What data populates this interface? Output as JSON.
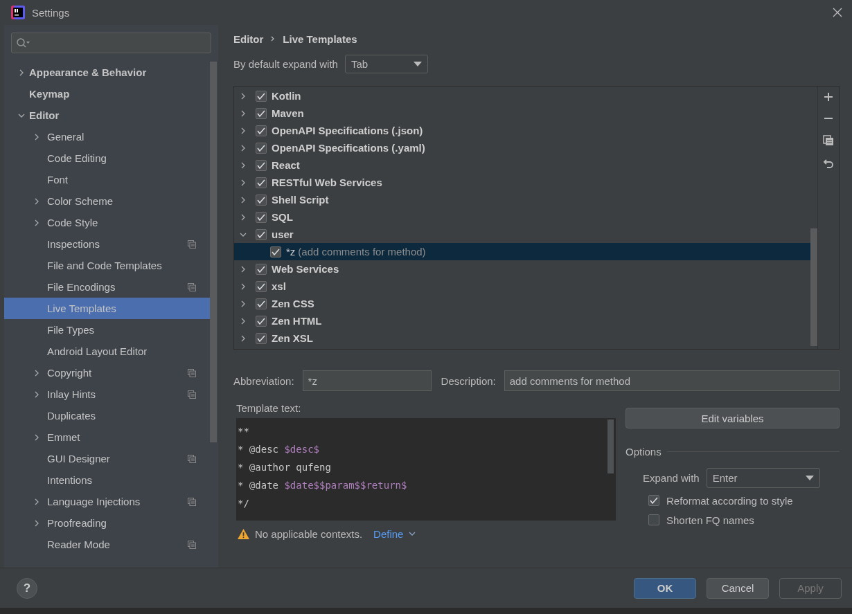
{
  "window": {
    "title": "Settings"
  },
  "sidebar": {
    "items": [
      {
        "name": "Appearance & Behavior",
        "bold": true,
        "expanded": false,
        "selected": false
      },
      {
        "name": "Keymap",
        "bold": true,
        "selected": false
      },
      {
        "name": "Editor",
        "bold": true,
        "expanded": true,
        "selected": false,
        "children": [
          {
            "name": "General",
            "expanded": false,
            "selected": false
          },
          {
            "name": "Code Editing",
            "selected": false
          },
          {
            "name": "Font",
            "selected": false
          },
          {
            "name": "Color Scheme",
            "expanded": false,
            "selected": false
          },
          {
            "name": "Code Style",
            "expanded": false,
            "selected": false
          },
          {
            "name": "Inspections",
            "project": true,
            "selected": false
          },
          {
            "name": "File and Code Templates",
            "selected": false
          },
          {
            "name": "File Encodings",
            "project": true,
            "selected": false
          },
          {
            "name": "Live Templates",
            "selected": true
          },
          {
            "name": "File Types",
            "selected": false
          },
          {
            "name": "Android Layout Editor",
            "selected": false
          },
          {
            "name": "Copyright",
            "expanded": false,
            "project": true,
            "selected": false
          },
          {
            "name": "Inlay Hints",
            "expanded": false,
            "project": true,
            "selected": false
          },
          {
            "name": "Duplicates",
            "selected": false
          },
          {
            "name": "Emmet",
            "expanded": false,
            "selected": false
          },
          {
            "name": "GUI Designer",
            "project": true,
            "selected": false
          },
          {
            "name": "Intentions",
            "selected": false
          },
          {
            "name": "Language Injections",
            "expanded": false,
            "project": true,
            "selected": false
          },
          {
            "name": "Proofreading",
            "expanded": false,
            "selected": false
          },
          {
            "name": "Reader Mode",
            "project": true,
            "selected": false
          }
        ]
      }
    ]
  },
  "breadcrumb": [
    "Editor",
    "Live Templates"
  ],
  "expand_default": {
    "label": "By default expand with",
    "value": "Tab"
  },
  "templates": [
    {
      "name": "Kotlin",
      "checked": true,
      "expanded": false,
      "selected": false
    },
    {
      "name": "Maven",
      "checked": true,
      "expanded": false,
      "selected": false
    },
    {
      "name": "OpenAPI Specifications (.json)",
      "checked": true,
      "expanded": false,
      "selected": false
    },
    {
      "name": "OpenAPI Specifications (.yaml)",
      "checked": true,
      "expanded": false,
      "selected": false
    },
    {
      "name": "React",
      "checked": true,
      "expanded": false,
      "selected": false
    },
    {
      "name": "RESTful Web Services",
      "checked": true,
      "expanded": false,
      "selected": false
    },
    {
      "name": "Shell Script",
      "checked": true,
      "expanded": false,
      "selected": false
    },
    {
      "name": "SQL",
      "checked": true,
      "expanded": false,
      "selected": false
    },
    {
      "name": "user",
      "checked": true,
      "expanded": true,
      "selected": false,
      "children": [
        {
          "name": "*z",
          "description": "(add comments for method)",
          "checked": true,
          "selected": true
        }
      ]
    },
    {
      "name": "Web Services",
      "checked": true,
      "expanded": false,
      "selected": false
    },
    {
      "name": "xsl",
      "checked": true,
      "expanded": false,
      "selected": false
    },
    {
      "name": "Zen CSS",
      "checked": true,
      "expanded": false,
      "selected": false
    },
    {
      "name": "Zen HTML",
      "checked": true,
      "expanded": false,
      "selected": false
    },
    {
      "name": "Zen XSL",
      "checked": true,
      "expanded": false,
      "selected": false
    }
  ],
  "abbreviation": {
    "label": "Abbreviation:",
    "value": "*z"
  },
  "description": {
    "label": "Description:",
    "value": "add comments for method"
  },
  "template_text": {
    "label": "Template text:",
    "lines": [
      [
        {
          "kind": "text",
          "text": "**"
        }
      ],
      [
        {
          "kind": "text",
          "text": "* @desc "
        },
        {
          "kind": "var",
          "text": "$desc$"
        }
      ],
      [
        {
          "kind": "text",
          "text": "* @author qufeng"
        }
      ],
      [
        {
          "kind": "text",
          "text": "* @date "
        },
        {
          "kind": "var",
          "text": "$date$$param$$return$"
        }
      ],
      [
        {
          "kind": "text",
          "text": "*/"
        }
      ]
    ]
  },
  "edit_variables": "Edit variables",
  "options": {
    "title": "Options",
    "expand_label": "Expand with",
    "expand_value": "Enter",
    "checkboxes": [
      {
        "label": "Reformat according to style",
        "checked": true
      },
      {
        "label": "Shorten FQ names",
        "checked": false
      }
    ]
  },
  "warning": {
    "text": "No applicable contexts.",
    "link": "Define"
  },
  "footer": {
    "help": "?",
    "buttons": [
      {
        "label": "OK",
        "kind": "primary"
      },
      {
        "label": "Cancel",
        "kind": "normal"
      },
      {
        "label": "Apply",
        "kind": "disabled"
      }
    ]
  }
}
